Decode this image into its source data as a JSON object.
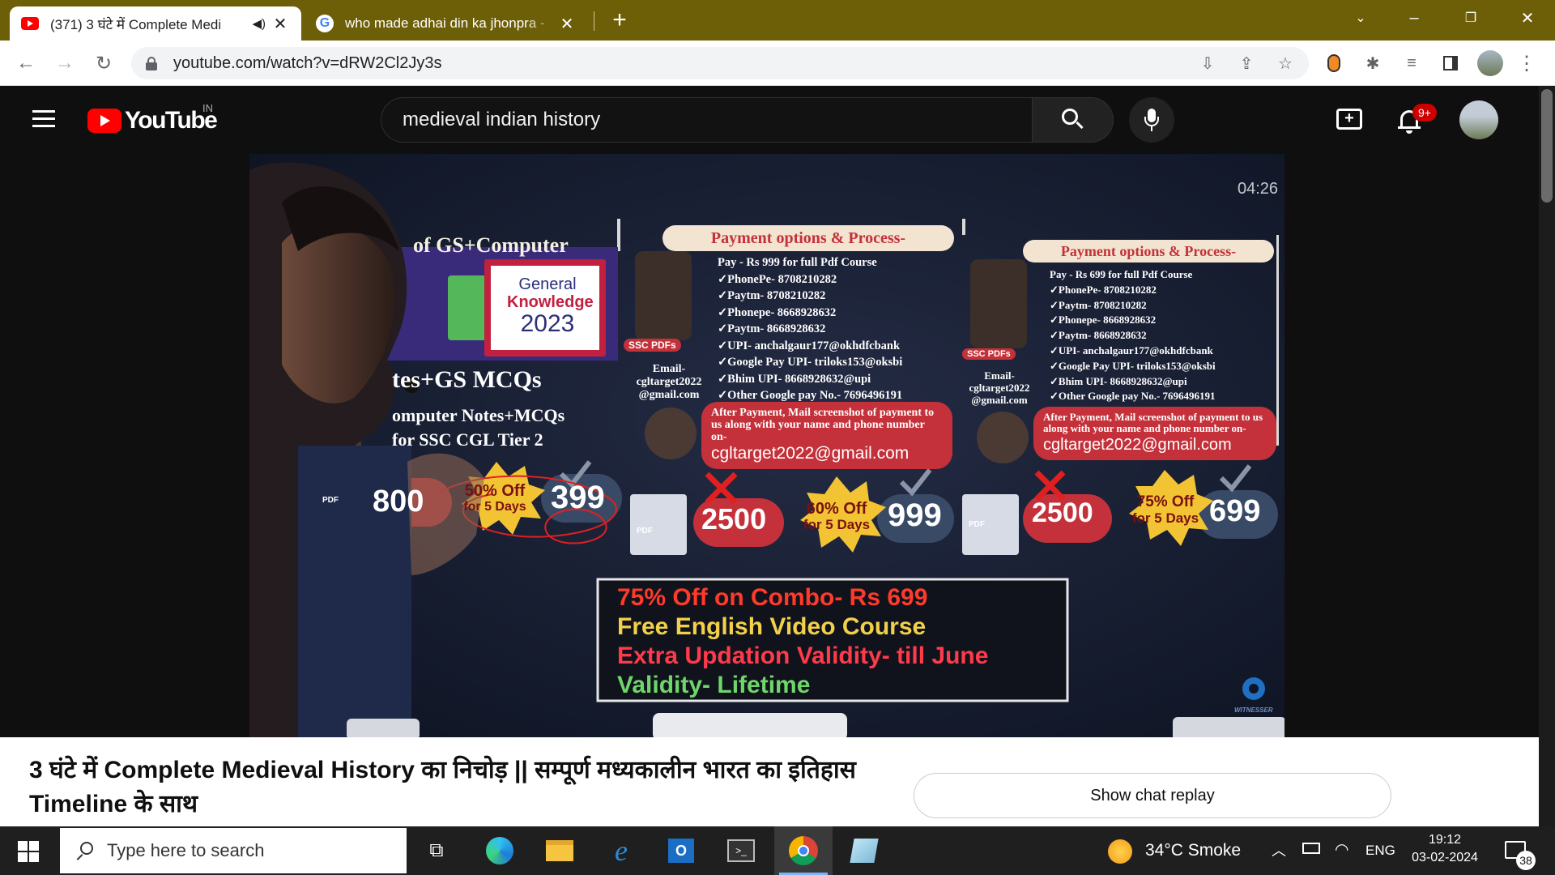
{
  "browser": {
    "tabs": [
      {
        "title": "(371) 3 घंटे में Complete Medi",
        "favicon": "youtube-icon",
        "active": true
      },
      {
        "title": "who made adhai din ka jhonpra -",
        "favicon": "google-icon",
        "active": false
      }
    ],
    "new_tab": "+",
    "url": "youtube.com/watch?v=dRW2Cl2Jy3s"
  },
  "youtube": {
    "logo_text": "YouTube",
    "country": "IN",
    "search_value": "medieval indian history",
    "notification_count": "9+"
  },
  "video": {
    "timestamp": "04:26",
    "left_panel": {
      "header": "of GS+Computer",
      "book_line1": "General",
      "book_line2": "Knowledge",
      "book_line3": "2023",
      "notes_line1": "tes+GS MCQs",
      "notes_line2": "omputer Notes+MCQs",
      "notes_line3": "for SSC CGL Tier 2",
      "price_old": "800",
      "discount_line1": "50% Off",
      "discount_line2": "for 5 Days",
      "price_new": "399"
    },
    "mid_panel": {
      "header": "Payment options & Process-",
      "badge": "SSC PDFs",
      "email_label": "Email-",
      "email_user": "cgltarget2022",
      "email_domain": "@gmail.com",
      "lines": [
        "Pay - Rs 999 for full Pdf Course",
        "✓PhonePe- 8708210282",
        "✓Paytm- 8708210282",
        "✓Phonepe- 8668928632",
        "✓Paytm- 8668928632",
        "✓UPI- anchalgaur177@okhdfcbank",
        "✓Google Pay UPI- triloks153@oksbi",
        "✓Bhim UPI- 8668928632@upi",
        "✓Other Google pay No.- 7696496191"
      ],
      "after_payment": "After Payment, Mail screenshot of payment to us along with your name and phone number on-",
      "contact_email": "cgltarget2022@gmail.com",
      "price_old": "2500",
      "discount_line1": "60% Off",
      "discount_line2": "for 5 Days",
      "price_new": "999"
    },
    "right_panel": {
      "header": "Payment options & Process-",
      "badge": "SSC PDFs",
      "email_label": "Email-",
      "email_user": "cgltarget2022",
      "email_domain": "@gmail.com",
      "lines": [
        "Pay - Rs 699 for full Pdf Course",
        "✓PhonePe- 8708210282",
        "✓Paytm- 8708210282",
        "✓Phonepe- 8668928632",
        "✓Paytm- 8668928632",
        "✓UPI- anchalgaur177@okhdfcbank",
        "✓Google Pay UPI- triloks153@oksbi",
        "✓Bhim UPI- 8668928632@upi",
        "✓Other Google pay No.- 7696496191"
      ],
      "after_payment": "After Payment, Mail screenshot of payment to us along with your name and phone number on-",
      "contact_email": "cgltarget2022@gmail.com",
      "price_old": "2500",
      "discount_line1": "75% Off",
      "discount_line2": "for 5 Days",
      "price_new": "699"
    },
    "combo_box": {
      "line1": "75% Off on Combo- Rs 699",
      "line2": "Free English Video Course",
      "line3": "Extra Updation Validity- till June",
      "line4": "Validity- Lifetime"
    },
    "watermark": "WITNESSER",
    "pdf_label": "PDF"
  },
  "below_video": {
    "title": "3 घंटे में Complete Medieval History का निचोड़ || सम्पूर्ण मध्यकालीन भारत का इतिहास Timeline के साथ",
    "chat_button": "Show chat replay"
  },
  "taskbar": {
    "search_placeholder": "Type here to search",
    "weather": "34°C  Smoke",
    "language": "ENG",
    "time": "19:12",
    "date": "03-02-2024",
    "notification_count": "38"
  },
  "colors": {
    "tabstrip": "#6d5e08",
    "youtube_red": "#ff0000",
    "video_bg": "#1a2233",
    "panel_red": "#c4313a",
    "accent_yellow": "#f2c433"
  }
}
